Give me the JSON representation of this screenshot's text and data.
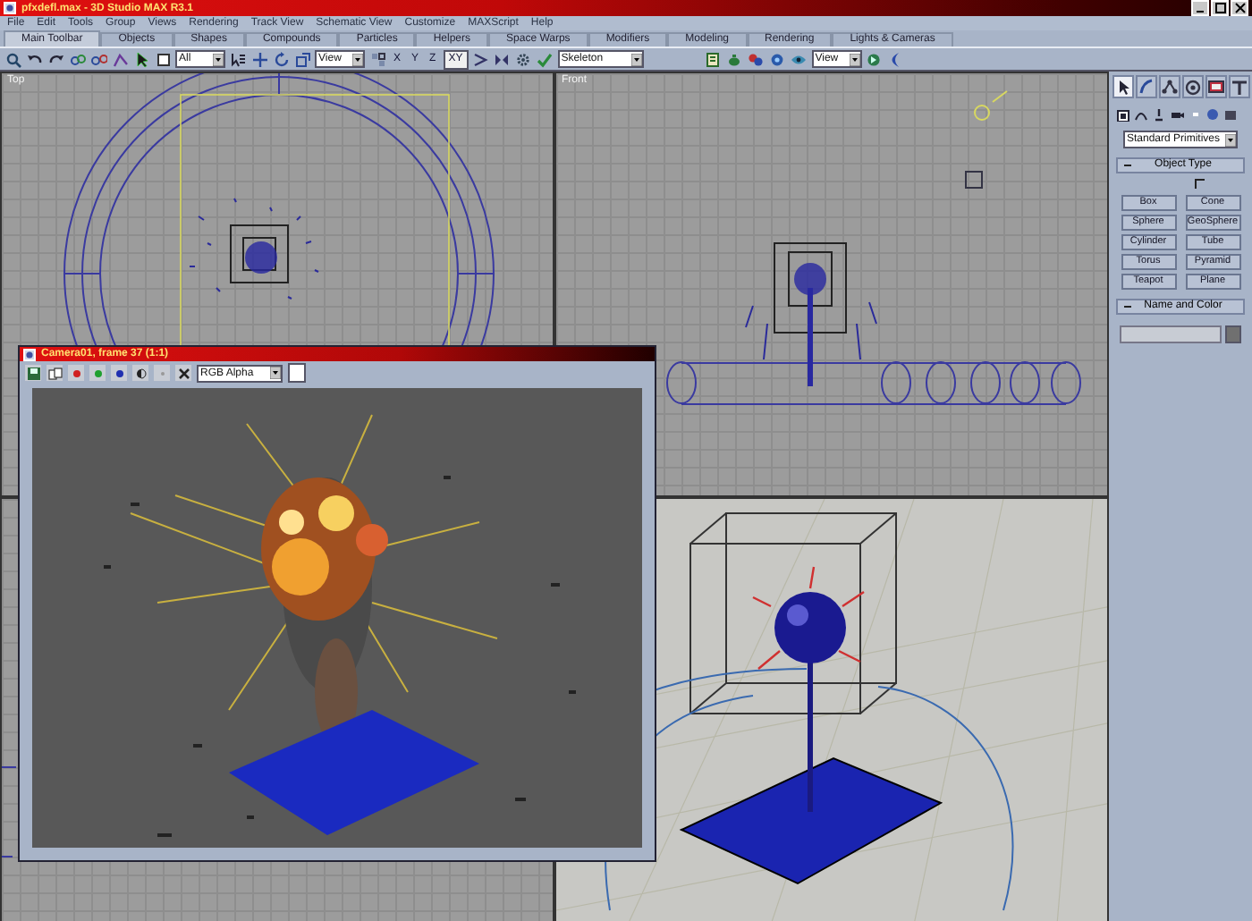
{
  "window": {
    "title": "pfxdefl.max - 3D Studio MAX R3.1"
  },
  "menu": [
    "File",
    "Edit",
    "Tools",
    "Group",
    "Views",
    "Rendering",
    "Track View",
    "Schematic View",
    "Customize",
    "MAXScript",
    "Help"
  ],
  "toolbar_tabs": [
    {
      "label": "Main Toolbar",
      "selected": true
    },
    {
      "label": "Objects",
      "selected": false
    },
    {
      "label": "Shapes",
      "selected": false
    },
    {
      "label": "Compounds",
      "selected": false
    },
    {
      "label": "Particles",
      "selected": false
    },
    {
      "label": "Helpers",
      "selected": false
    },
    {
      "label": "Space Warps",
      "selected": false
    },
    {
      "label": "Modifiers",
      "selected": false
    },
    {
      "label": "Modeling",
      "selected": false
    },
    {
      "label": "Rendering",
      "selected": false
    },
    {
      "label": "Lights & Cameras",
      "selected": false
    }
  ],
  "toolbar": {
    "selection_filter": "All",
    "reference_coordinates": "View",
    "axes": [
      {
        "label": "X",
        "selected": false
      },
      {
        "label": "Y",
        "selected": false
      },
      {
        "label": "Z",
        "selected": false
      },
      {
        "label": "XY",
        "selected": true
      }
    ],
    "named_selection": "Skeleton",
    "render_type": "View"
  },
  "viewports": [
    {
      "label": "Top",
      "kind": "top"
    },
    {
      "label": "Front",
      "kind": "front"
    },
    {
      "kind": "left"
    },
    {
      "kind": "perspective"
    }
  ],
  "command_panel": {
    "tabs": [
      {
        "selected": true
      },
      {
        "selected": false
      },
      {
        "selected": false
      },
      {
        "selected": false
      },
      {
        "selected": false
      },
      {
        "selected": false
      }
    ],
    "category": "Standard Primitives",
    "object_type": {
      "title": "Object Type",
      "buttons": [
        "Box",
        "Cone",
        "Sphere",
        "GeoSphere",
        "Cylinder",
        "Tube",
        "Torus",
        "Pyramid",
        "Teapot",
        "Plane"
      ]
    },
    "name_and_color": {
      "title": "Name and Color"
    }
  },
  "render_window": {
    "title": "Camera01, frame 37 (1:1)",
    "channel": "RGB Alpha"
  }
}
